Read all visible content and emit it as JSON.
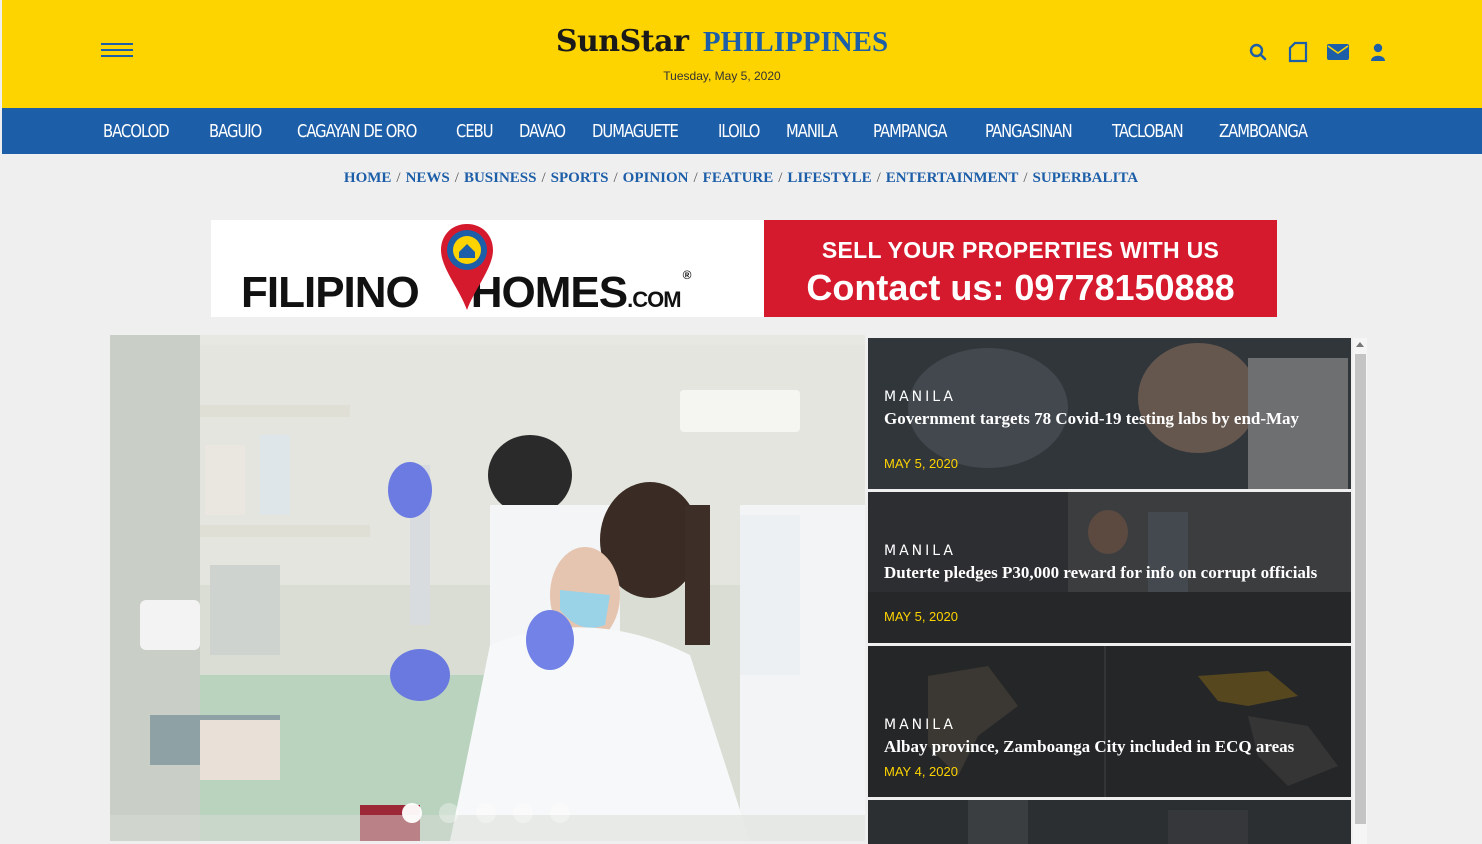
{
  "header": {
    "logo": "SunStar",
    "edition": "PHILIPPINES",
    "date": "Tuesday, May 5, 2020",
    "icons": [
      "search-icon",
      "tablet-icon",
      "mail-icon",
      "user-icon"
    ],
    "colors": {
      "yellow": "#fed400",
      "blue": "#1d5ea8"
    }
  },
  "cities": [
    "BACOLOD",
    "BAGUIO",
    "CAGAYAN DE ORO",
    "CEBU",
    "DAVAO",
    "DUMAGUETE",
    "ILOILO",
    "MANILA",
    "PAMPANGA",
    "PANGASINAN",
    "TACLOBAN",
    "ZAMBOANGA"
  ],
  "sections": [
    "HOME",
    "NEWS",
    "BUSINESS",
    "SPORTS",
    "OPINION",
    "FEATURE",
    "LIFESTYLE",
    "ENTERTAINMENT",
    "SUPERBALITA"
  ],
  "ad": {
    "brand": "FILIPINO",
    "brand2": "HOMES",
    "dotcom": ".COM",
    "reg": "®",
    "line1": "SELL YOUR PROPERTIES WITH US",
    "line2": "Contact us: 09778150888",
    "color": "#d61a2d"
  },
  "carousel": {
    "slides": 5,
    "active": 1
  },
  "stories": [
    {
      "category": "MANILA",
      "title": "Government targets 78 Covid-19 testing labs by end-May",
      "date": "MAY 5, 2020"
    },
    {
      "category": "MANILA",
      "title": "Duterte pledges P30,000 reward for info on corrupt officials",
      "date": "MAY 5, 2020"
    },
    {
      "category": "MANILA",
      "title": "Albay province, Zamboanga City included in ECQ areas",
      "date": "MAY 4, 2020"
    }
  ]
}
